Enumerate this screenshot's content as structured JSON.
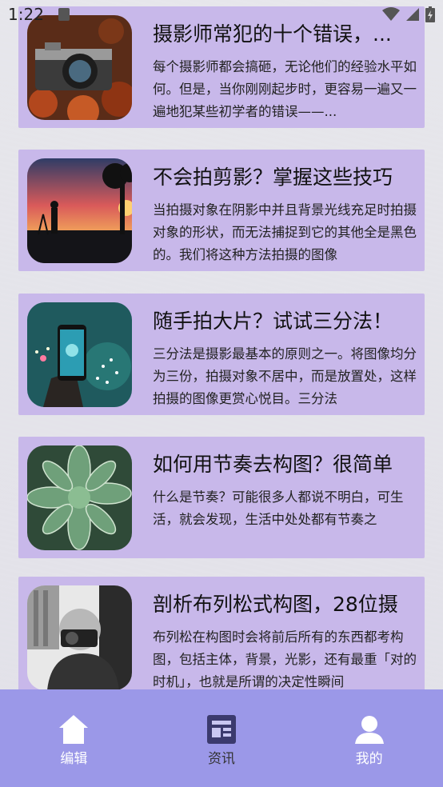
{
  "status_bar": {
    "time": "1:22"
  },
  "articles": [
    {
      "title": "摄影师常犯的十个错误，...",
      "excerpt": "每个摄影师都会搞砸，无论他们的经验水平如何。但是，当你刚刚起步时，更容易一遍又一遍地犯某些初学者的错误——...",
      "thumb_icon": "camera-photo-icon"
    },
    {
      "title": "不会拍剪影？掌握这些技巧",
      "excerpt": "当拍摄对象在阴影中并且背景光线充足时拍摄对象的形状，而无法捕捉到它的其他全是黑色的。我们将这种方法拍摄的图像",
      "thumb_icon": "silhouette-photo-icon"
    },
    {
      "title": "随手拍大片？试试三分法！",
      "excerpt": "三分法是摄影最基本的原则之一。将图像均分为三份，拍摄对象不居中，而是放置处，这样拍摄的图像更赏心悦目。三分法",
      "thumb_icon": "fireworks-phone-photo-icon"
    },
    {
      "title": "如何用节奏去构图？很简单",
      "excerpt": "什么是节奏？可能很多人都说不明白，可生活，就会发现，生活中处处都有节奏之",
      "thumb_icon": "succulent-photo-icon"
    },
    {
      "title": "剖析布列松式构图，28位摄",
      "excerpt": "布列松在构图时会将前后所有的东西都考构图，包括主体，背景，光影，还有最重「对的时机」，也就是所谓的决定性瞬间",
      "thumb_icon": "photographer-portrait-icon"
    }
  ],
  "bottom_nav": {
    "items": [
      {
        "label": "编辑",
        "icon": "home-icon",
        "active": false
      },
      {
        "label": "资讯",
        "icon": "news-icon",
        "active": true
      },
      {
        "label": "我的",
        "icon": "profile-icon",
        "active": false
      }
    ]
  },
  "colors": {
    "card_bg": "#c8b8ea",
    "nav_bg": "#9b98e8",
    "nav_active_icon": "#3b3a6e"
  }
}
